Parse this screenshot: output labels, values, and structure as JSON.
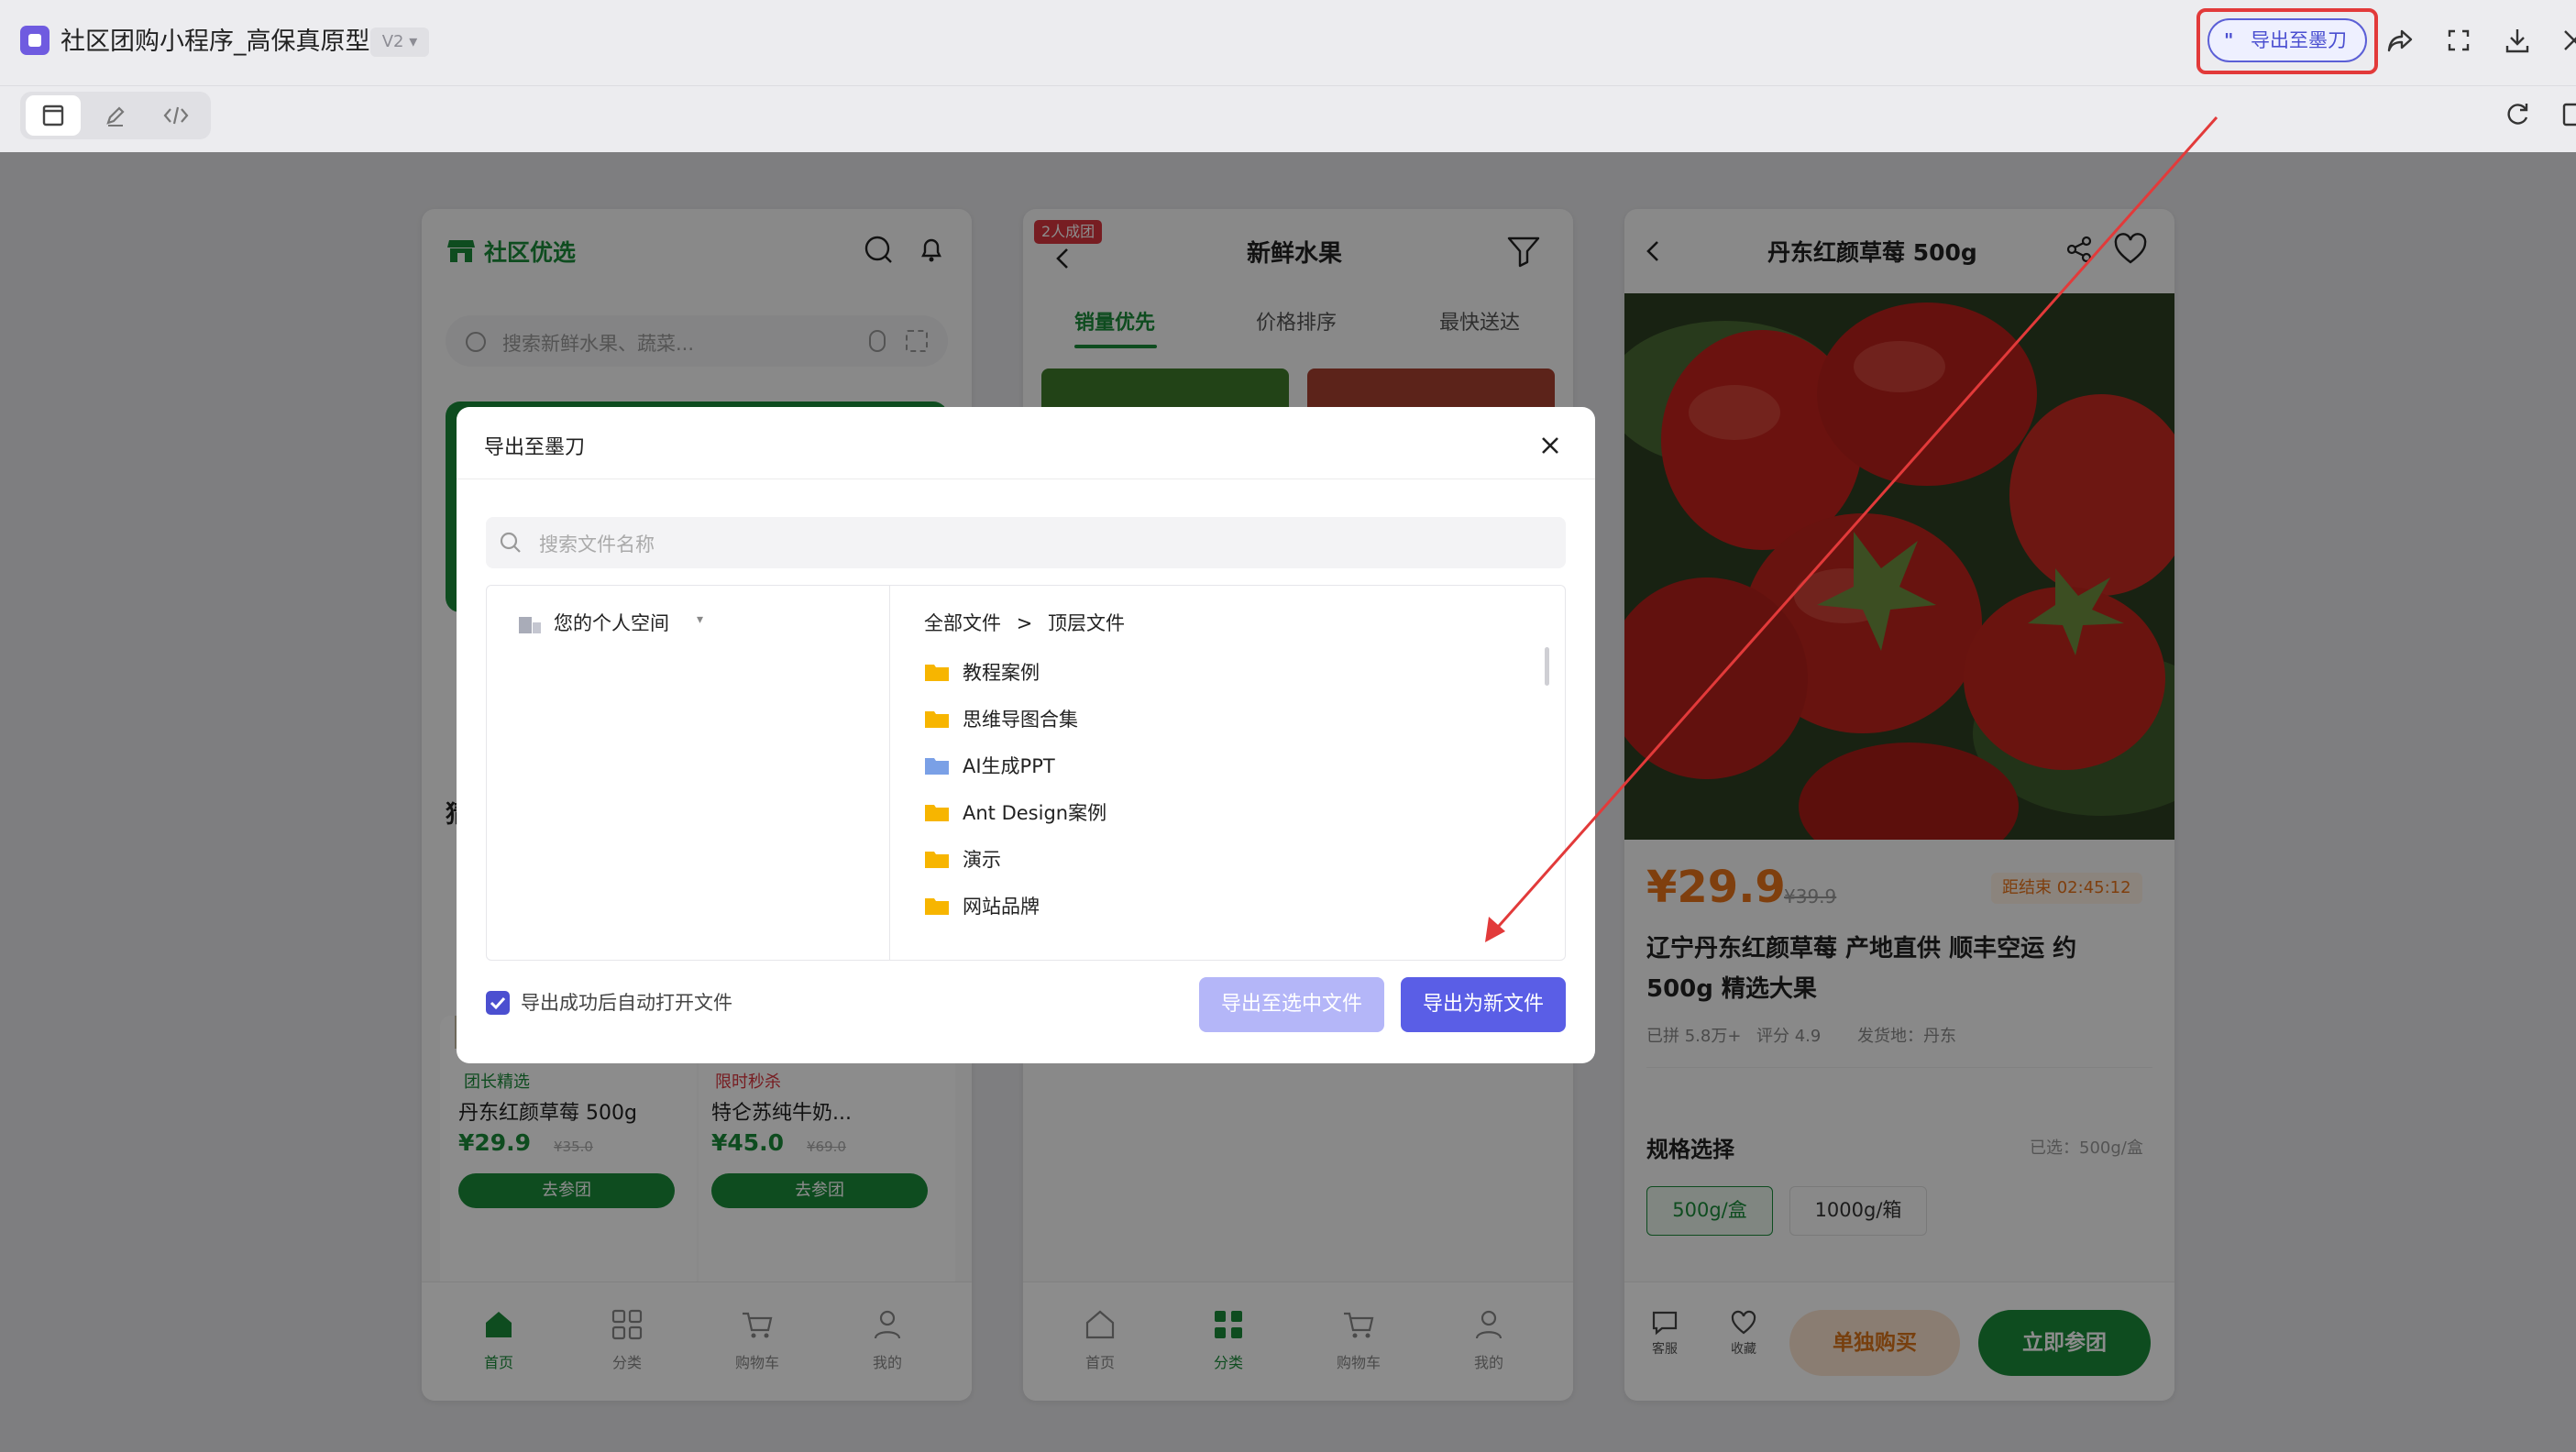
{
  "header": {
    "title": "社区团购小程序_高保真原型",
    "version": "V2",
    "export_label": "导出至墨刀"
  },
  "phone1": {
    "brand": "社区优选",
    "search_placeholder": "搜索新鲜水果、蔬菜...",
    "section_initial": "猜",
    "products": [
      {
        "tag": "团长精选",
        "name": "丹东红颜草莓 500g",
        "price": "¥29.9",
        "old": "¥35.0",
        "btn": "去参团"
      },
      {
        "tag": "限时秒杀",
        "name": "特仑苏纯牛奶...",
        "price": "¥45.0",
        "old": "¥69.0",
        "btn": "去参团"
      }
    ],
    "nav": [
      "首页",
      "分类",
      "购物车",
      "我的"
    ]
  },
  "phone2": {
    "badge": "2人成团",
    "title": "新鲜水果",
    "tabs": [
      "销量优先",
      "价格排序",
      "最快送达"
    ],
    "nav": [
      "首页",
      "分类",
      "购物车",
      "我的"
    ]
  },
  "phone3": {
    "title": "丹东红颜草莓 500g",
    "price": "¥29.9",
    "old_price": "¥39.9",
    "countdown": "距结束 02:45:12",
    "product_title_line1": "辽宁丹东红颜草莓 产地直供 顺丰空运 约",
    "product_title_line2": "500g 精选大果",
    "meta": [
      "已拼 5.8万+",
      "评分 4.9",
      "发货地：丹东"
    ],
    "spec_label": "规格选择",
    "spec_selected": "已选：500g/盒",
    "specs": [
      "500g/盒",
      "1000g/箱"
    ],
    "service_label": "客服",
    "fav_label": "收藏",
    "buy_single": "单独购买",
    "join_group": "立即参团"
  },
  "modal": {
    "title": "导出至墨刀",
    "search_placeholder": "搜索文件名称",
    "space_label": "您的个人空间",
    "crumb_root": "全部文件",
    "crumb_sep": ">",
    "crumb_current": "顶层文件",
    "folders": [
      {
        "name": "教程案例",
        "color": "#f7b500"
      },
      {
        "name": "思维导图合集",
        "color": "#f7b500"
      },
      {
        "name": "AI生成PPT",
        "color": "#7aa0e6"
      },
      {
        "name": "Ant Design案例",
        "color": "#f7b500"
      },
      {
        "name": "演示",
        "color": "#f7b500"
      },
      {
        "name": "网站品牌",
        "color": "#f7b500"
      }
    ],
    "auto_open_label": "导出成功后自动打开文件",
    "btn_export_selected": "导出至选中文件",
    "btn_export_new": "导出为新文件"
  },
  "colors": {
    "brand_green": "#1a8a3a",
    "accent_purple": "#5a5ee6",
    "price_orange": "#e8731a",
    "highlight_red": "#e23a3a"
  }
}
